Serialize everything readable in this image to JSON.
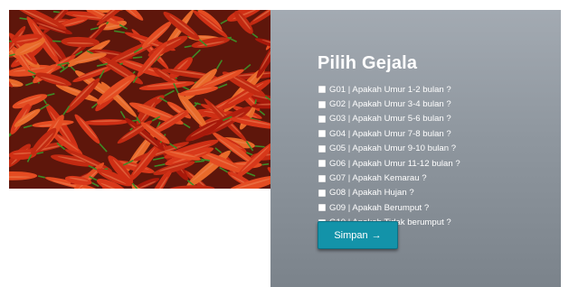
{
  "form": {
    "title": "Pilih Gejala",
    "symptoms": [
      "G01 | Apakah Umur 1-2 bulan ?",
      "G02 | Apakah Umur 3-4 bulan ?",
      "G03 | Apakah Umur 5-6 bulan ?",
      "G04 | Apakah Umur 7-8 bulan ?",
      "G05 | Apakah Umur 9-10 bulan ?",
      "G06 | Apakah Umur 11-12 bulan ?",
      "G07 | Apakah Kemarau ?",
      "G08 | Apakah Hujan ?",
      "G09 | Apakah Berumput ?",
      "G10 | Apakah Tidak berumput ?"
    ],
    "submit_label": "Simpan",
    "submit_icon": "→"
  },
  "colors": {
    "panel_top": "#a3aab2",
    "panel_bottom": "#7b838b",
    "button": "#1393a9"
  }
}
